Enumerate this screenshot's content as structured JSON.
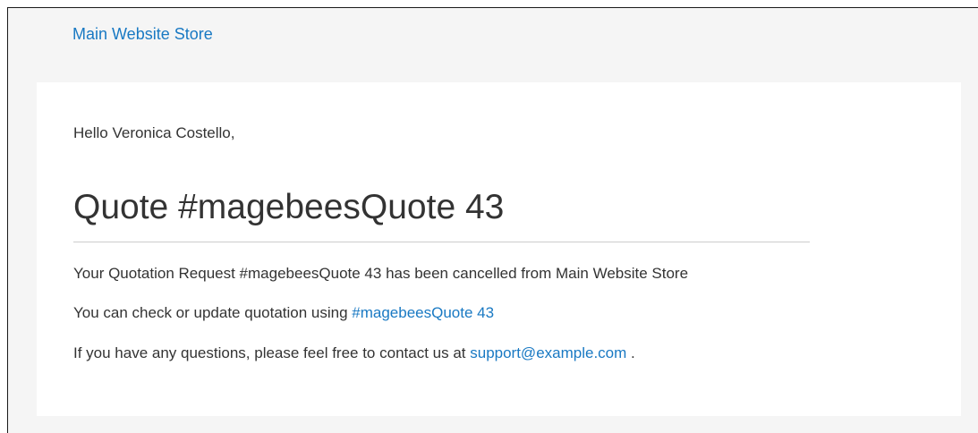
{
  "header": {
    "store_link": "Main Website Store"
  },
  "email": {
    "greeting": "Hello Veronica Costello,",
    "title": "Quote #magebeesQuote 43",
    "line1": "Your Quotation Request #magebeesQuote 43 has been cancelled from Main Website Store",
    "line2_prefix": "You can check or update quotation using ",
    "line2_link": "#magebeesQuote 43",
    "line3_prefix": "If you have any questions, please feel free to contact us at ",
    "line3_link": "support@example.com",
    "line3_suffix": " ."
  },
  "colors": {
    "link": "#1979c3",
    "text": "#333333",
    "background": "#f5f5f5",
    "card": "#ffffff"
  }
}
